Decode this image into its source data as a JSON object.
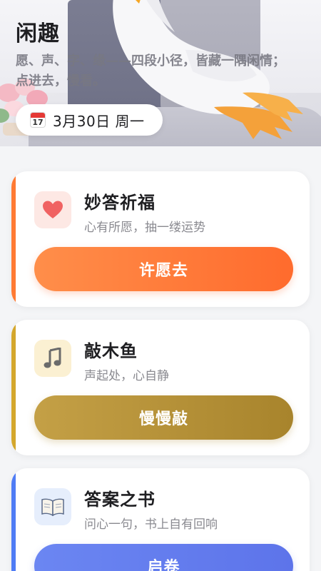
{
  "hero": {
    "title": "闲趣",
    "subtitle": "愿、声、字、缘——四段小径，皆藏一隅闲情；点进去，慢看。",
    "calendar_day": "17",
    "date": "3月30日 周一"
  },
  "cards": [
    {
      "title": "妙答祈福",
      "desc": "心有所愿，抽一缕运势",
      "button": "许愿去",
      "icon": "heart-icon",
      "accent_color": "#ff7a33"
    },
    {
      "title": "敲木鱼",
      "desc": "声起处，心自静",
      "button": "慢慢敲",
      "icon": "music-note-icon",
      "accent_color": "#d4a72c"
    },
    {
      "title": "答案之书",
      "desc": "问心一句，书上自有回响",
      "button": "启卷",
      "icon": "open-book-icon",
      "accent_color": "#4f7cf5"
    }
  ]
}
